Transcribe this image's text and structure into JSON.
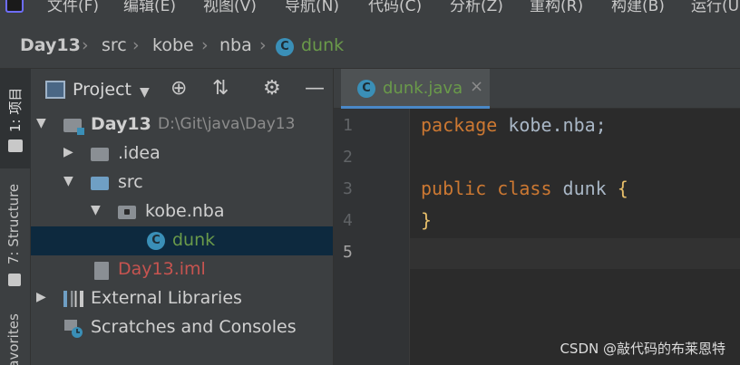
{
  "menu": {
    "items": [
      "文件(F)",
      "编辑(E)",
      "视图(V)",
      "导航(N)",
      "代码(C)",
      "分析(Z)",
      "重构(R)",
      "构建(B)",
      "运行(U)"
    ]
  },
  "breadcrumb": {
    "items": [
      "Day13",
      "src",
      "kobe",
      "nba",
      "dunk"
    ],
    "class_icon_glyph": "C"
  },
  "left_stripe": {
    "tabs": [
      "1: 项目",
      "7: Structure",
      "Favorites"
    ]
  },
  "project_panel": {
    "title": "Project",
    "header_icons": [
      "globe-icon",
      "collapse-icon",
      "gear-icon",
      "minimize-icon"
    ],
    "tree": {
      "root_name": "Day13",
      "root_path": "D:\\Git\\java\\Day13",
      "idea": ".idea",
      "src": "src",
      "package": "kobe.nba",
      "class_file": "dunk",
      "iml": "Day13.iml",
      "external_libraries": "External Libraries",
      "scratches": "Scratches and Consoles"
    }
  },
  "editor": {
    "tab_label": "dunk.java",
    "tab_close": "×",
    "line_numbers": [
      "1",
      "2",
      "3",
      "4",
      "5"
    ],
    "code": {
      "line1_keyword": "package",
      "line1_rest": " kobe.nba;",
      "line3_kw1": "public",
      "line3_kw2": " class",
      "line3_name": " dunk",
      "line3_brace": " {",
      "line4_brace": "}"
    }
  },
  "watermark": "CSDN @敲代码的布莱恩特",
  "colors": {
    "keyword": "#cc7832",
    "text": "#a9b7c6",
    "brace": "#e8bf6a",
    "file_green": "#6a9a4a",
    "iml_red": "#c75450",
    "selection": "#0d293e",
    "class_icon": "#3a8fb7"
  }
}
